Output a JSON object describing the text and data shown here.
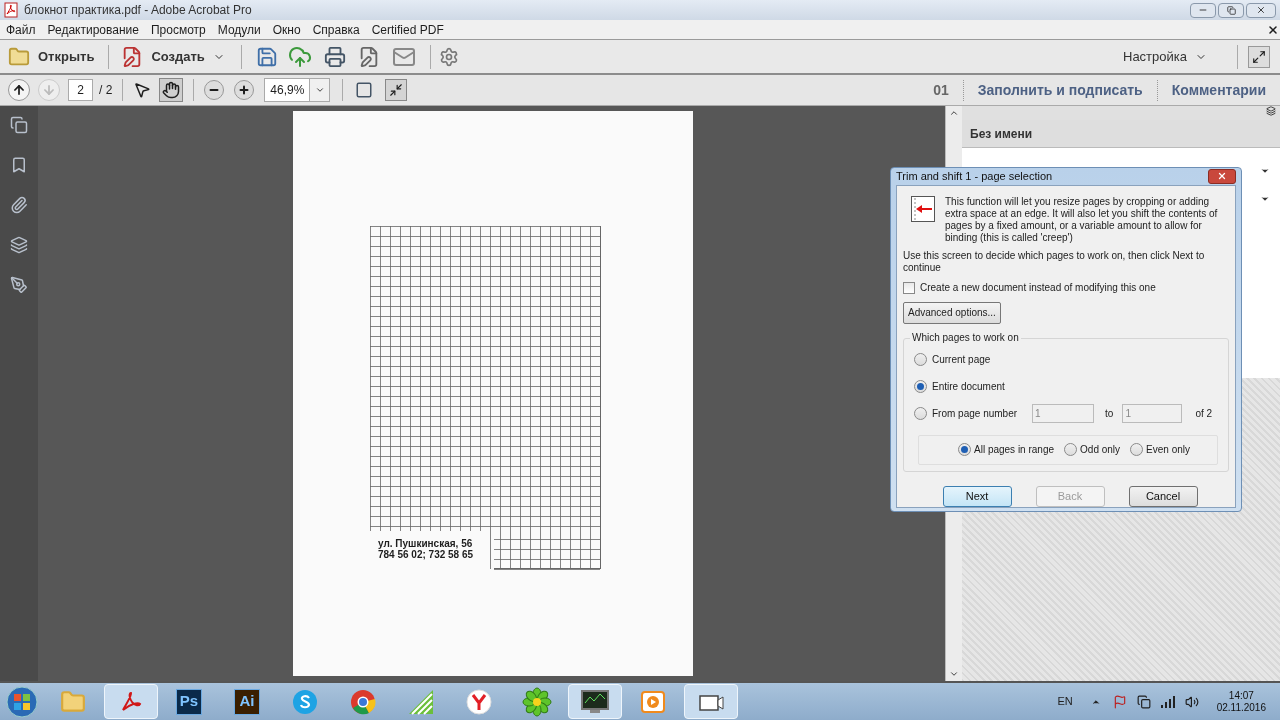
{
  "window": {
    "title": "блокнот практика.pdf - Adobe Acrobat Pro"
  },
  "menu": [
    "Файл",
    "Редактирование",
    "Просмотр",
    "Модули",
    "Окно",
    "Справка",
    "Certified PDF"
  ],
  "toolbar": {
    "open": "Открыть",
    "create": "Создать",
    "customize": "Настройка"
  },
  "nav": {
    "page": "2",
    "page_total": "/ 2",
    "zoom": "46,9%",
    "hand_selected": true,
    "count": "01",
    "tabs": [
      "Заполнить и подписать",
      "Комментарии"
    ]
  },
  "document": {
    "address_lines": [
      "ул. Пушкинская, 56",
      "784 56 02; 732 58 65"
    ]
  },
  "right_panel": {
    "heading": "Без имени"
  },
  "dialog": {
    "title": "Trim and shift 1 - page selection",
    "intro": "This function will let you resize pages by cropping or adding extra space at an edge. It will also let you shift the contents of pages by a fixed amount, or a variable amount to allow for binding (this is called 'creep')",
    "hint": "Use this screen to decide which pages to work on, then click Next to continue",
    "new_document": {
      "label": "Create a new document instead of modifying this one",
      "checked": false
    },
    "advanced": "Advanced options...",
    "group_title": "Which pages to work on",
    "scope": [
      {
        "label": "Current page",
        "selected": false
      },
      {
        "label": "Entire document",
        "selected": true
      },
      {
        "label": "From page number",
        "selected": false
      }
    ],
    "from": "1",
    "to_label": "to",
    "to": "1",
    "of": "of 2",
    "subset": [
      {
        "label": "All pages in range",
        "selected": true
      },
      {
        "label": "Odd only",
        "selected": false
      },
      {
        "label": "Even only",
        "selected": false
      }
    ],
    "buttons": [
      {
        "label": "Next",
        "disabled": false
      },
      {
        "label": "Back",
        "disabled": true
      },
      {
        "label": "Cancel",
        "disabled": false
      }
    ]
  },
  "taskbar": {
    "apps": [
      {
        "kind": "explorer",
        "selected": false
      },
      {
        "kind": "acrobat",
        "selected": true
      },
      {
        "kind": "text",
        "label": "Ps",
        "color": "#0a2a4a",
        "selected": false
      },
      {
        "kind": "text",
        "label": "Ai",
        "color": "#3a1f00",
        "selected": false
      },
      {
        "kind": "skype",
        "selected": false
      },
      {
        "kind": "chrome",
        "selected": false
      },
      {
        "kind": "corel",
        "selected": false
      },
      {
        "kind": "yandex",
        "selected": false
      },
      {
        "kind": "icq",
        "selected": false
      },
      {
        "kind": "monitor",
        "selected": true
      },
      {
        "kind": "player",
        "selected": false
      },
      {
        "kind": "video",
        "selected": true
      }
    ],
    "lang": "EN",
    "time": "14:07",
    "date": "02.11.2016"
  }
}
